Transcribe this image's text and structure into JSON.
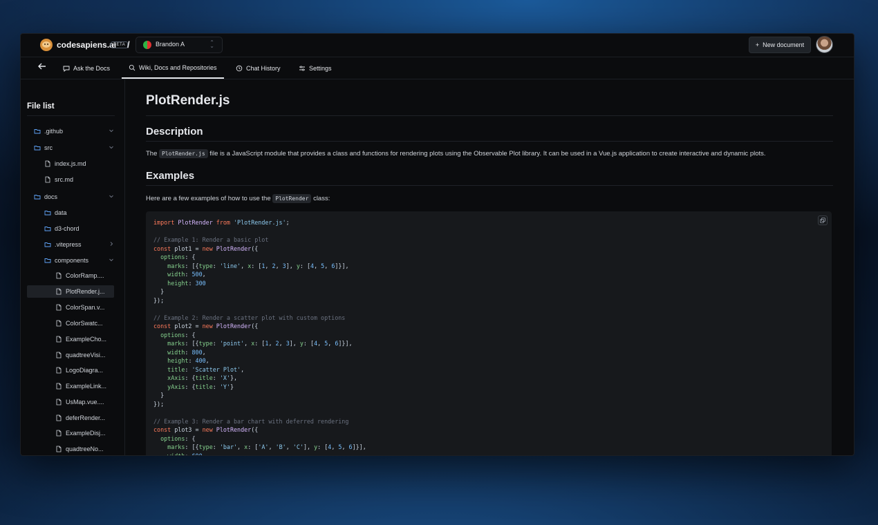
{
  "header": {
    "brand": "codesapiens.ai",
    "beta": "BETA",
    "separator": "/",
    "user": "Brandon A",
    "new_document": "New document",
    "new_document_icon": "+"
  },
  "tabs": [
    {
      "label": "Ask the Docs",
      "icon": "chat-icon"
    },
    {
      "label": "Wiki, Docs and Repositories",
      "icon": "search-doc-icon",
      "active": true
    },
    {
      "label": "Chat History",
      "icon": "history-icon"
    },
    {
      "label": "Settings",
      "icon": "sliders-icon"
    }
  ],
  "sidebar": {
    "title": "File list",
    "items": [
      {
        "label": ".github",
        "type": "folder",
        "chevron": "down"
      },
      {
        "label": "src",
        "type": "folder",
        "chevron": "down"
      },
      {
        "label": "index.js.md",
        "type": "file"
      },
      {
        "label": "src.md",
        "type": "file"
      },
      {
        "label": "docs",
        "type": "folder",
        "chevron": "down"
      },
      {
        "label": "data",
        "type": "folder"
      },
      {
        "label": "d3-chord",
        "type": "folder"
      },
      {
        "label": ".vitepress",
        "type": "folder",
        "chevron": "right"
      },
      {
        "label": "components",
        "type": "folder",
        "chevron": "down"
      },
      {
        "label": "ColorRamp....",
        "type": "file"
      },
      {
        "label": "PlotRender.j...",
        "type": "file",
        "selected": true
      },
      {
        "label": "ColorSpan.v...",
        "type": "file"
      },
      {
        "label": "ColorSwatc...",
        "type": "file"
      },
      {
        "label": "ExampleCho...",
        "type": "file"
      },
      {
        "label": "quadtreeVisi...",
        "type": "file"
      },
      {
        "label": "LogoDiagra...",
        "type": "file"
      },
      {
        "label": "ExampleLink...",
        "type": "file"
      },
      {
        "label": "UsMap.vue....",
        "type": "file"
      },
      {
        "label": "deferRender...",
        "type": "file"
      },
      {
        "label": "ExampleDisj...",
        "type": "file"
      },
      {
        "label": "quadtreeNo...",
        "type": "file"
      }
    ]
  },
  "doc": {
    "title": "PlotRender.js",
    "description_heading": "Description",
    "description_pre": "The",
    "description_code": "PlotRender.js",
    "description_post": "file is a JavaScript module that provides a class and functions for rendering plots using the Observable Plot library. It can be used in a Vue.js application to create interactive and dynamic plots.",
    "examples_heading": "Examples",
    "examples_pre": "Here are a few examples of how to use the",
    "examples_code": "PlotRender",
    "examples_post": "class:"
  },
  "colors": {
    "window_bg": "#0b0c0e",
    "code_bg": "#17191c",
    "keyword": "#ff7b5c",
    "string": "#8ecbf0",
    "comment": "#6b7280"
  }
}
